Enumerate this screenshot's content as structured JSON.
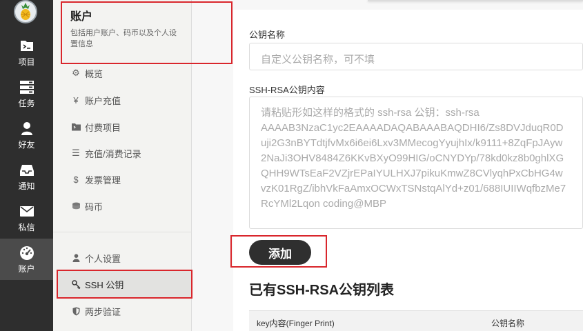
{
  "leftnav": {
    "items": [
      {
        "label": "项目",
        "icon": "folder-terminal-icon"
      },
      {
        "label": "任务",
        "icon": "task-list-icon"
      },
      {
        "label": "好友",
        "icon": "user-icon"
      },
      {
        "label": "通知",
        "icon": "inbox-icon"
      },
      {
        "label": "私信",
        "icon": "envelope-icon"
      },
      {
        "label": "账户",
        "icon": "dashboard-icon"
      }
    ],
    "active": "账户"
  },
  "sidebar": {
    "title": "账户",
    "description": "包括用户账户、码币以及个人设置信息",
    "items": [
      {
        "label": "概览",
        "icon": "cogs-icon"
      },
      {
        "label": "账户充值",
        "icon": "yen-icon"
      },
      {
        "label": "付费项目",
        "icon": "folder-terminal-icon"
      },
      {
        "label": "充值/消费记录",
        "icon": "list-icon"
      },
      {
        "label": "发票管理",
        "icon": "dollar-icon"
      },
      {
        "label": "码币",
        "icon": "coins-icon"
      },
      {
        "label": "个人设置",
        "icon": "user-icon"
      },
      {
        "label": "SSH 公钥",
        "icon": "key-icon"
      },
      {
        "label": "两步验证",
        "icon": "shield-icon"
      }
    ],
    "selected": "SSH 公钥"
  },
  "form": {
    "name_label": "公钥名称",
    "name_placeholder": "自定义公钥名称，可不填",
    "content_label": "SSH-RSA公钥内容",
    "content_placeholder_lines": [
      "请粘贴形如这样的格式的 ssh-rsa 公钥：ssh-rsa",
      "AAAAB3NzaC1yc2EAAAADAQABAAABAQDHI6/Zs8DVJduqR0D",
      "uji2G3nBYTdtjfvMx6i6ei6Lxv3MMecogYyujhIx/k9111+8ZqFpJAyw",
      "2NaJi3OHV8484Z6KKvBXyO99HIG/oCNYDYp/78kd0kz8b0ghlXG",
      "QHH9WTsEaF2VZjrEPaIYULHXJ7pikuKmwZ8CVlyqhPxCbHG4w",
      "vzK01RgZ/ibhVkFaAmxOCWxTSNstqAlYd+z01/688IUIIWqfbzMe7",
      "RcYMl2Lqon coding@MBP"
    ],
    "add_button": "添加"
  },
  "key_list": {
    "title": "已有SSH-RSA公钥列表",
    "columns": [
      "key内容(Finger Print)",
      "公钥名称"
    ]
  },
  "colors": {
    "nav_bg": "#2e2e2e",
    "accent_dark": "#2f2f2f",
    "annotation_red": "#d9262c"
  }
}
